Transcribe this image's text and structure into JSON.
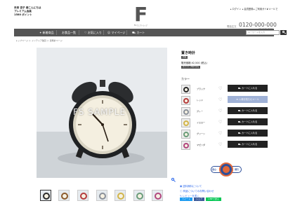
{
  "header": {
    "user": {
      "line1": "未来 杏子 様こんにちは",
      "line2": "プレミアム会員",
      "line3": "1580 ポイント"
    },
    "top_links": [
      "ログイン",
      "会員登録",
      "ご利用ガイド",
      "メールで"
    ],
    "logo": {
      "letter": "F",
      "caption": "FS ウェブショップ"
    },
    "phone_label": "電話注文",
    "phone": "0120-000-000",
    "phone_hours": "(平日 9:00-18:00)"
  },
  "nav": {
    "items": [
      "新着商品",
      "お食品一覧",
      "お気に入り",
      "マイページ",
      "カート"
    ],
    "search_placeholder": "キーワードを入力"
  },
  "breadcrumb": "トップページ ＞ インテリア雑貨 ＞ 置時計ページ",
  "image": {
    "watermark": "FS SAMPLE"
  },
  "product": {
    "title": "置き時計",
    "new_badge": "新着",
    "price": "販売価格 ¥2,500 (税込)",
    "point_badge": "ポイント 25pt 付与",
    "color_label": "カラー",
    "colors": [
      {
        "name": "ブラック",
        "button": "カートに入れる",
        "frame": "#2a2a2a"
      },
      {
        "name": "レッド",
        "button": "入荷お知らせメール",
        "frame": "#b53b3b"
      },
      {
        "name": "グレー",
        "button": "カートに入れる",
        "frame": "#8a9099"
      },
      {
        "name": "イエロー",
        "button": "カートに入れる",
        "frame": "#d2b54a"
      },
      {
        "name": "グリーン",
        "button": "カートに入れる",
        "frame": "#6a9c7a"
      },
      {
        "name": "マゼンダ",
        "button": "カートに入れる",
        "frame": "#b1477e"
      }
    ],
    "badge": {
      "left": "安心",
      "right": "発行"
    },
    "links": [
      "送料無料について",
      "商品についてのお問い合わせ",
      "レビューを書く"
    ],
    "share": [
      "ツイート",
      "シェア",
      "LINEで送る"
    ]
  },
  "thumbnails": [
    {
      "frame": "#2a2a2a"
    },
    {
      "frame": "#8b5a2b"
    },
    {
      "frame": "#b53b3b"
    },
    {
      "frame": "#8a9099"
    },
    {
      "frame": "#d2b54a"
    },
    {
      "frame": "#6a9c7a"
    },
    {
      "frame": "#b1477e"
    },
    {
      "frame": "#5b7fa6"
    }
  ],
  "colors": {
    "nav_bg": "#555555",
    "button_bg": "#222222",
    "alt_button_bg": "#9fb1d6",
    "link": "#2563eb"
  }
}
